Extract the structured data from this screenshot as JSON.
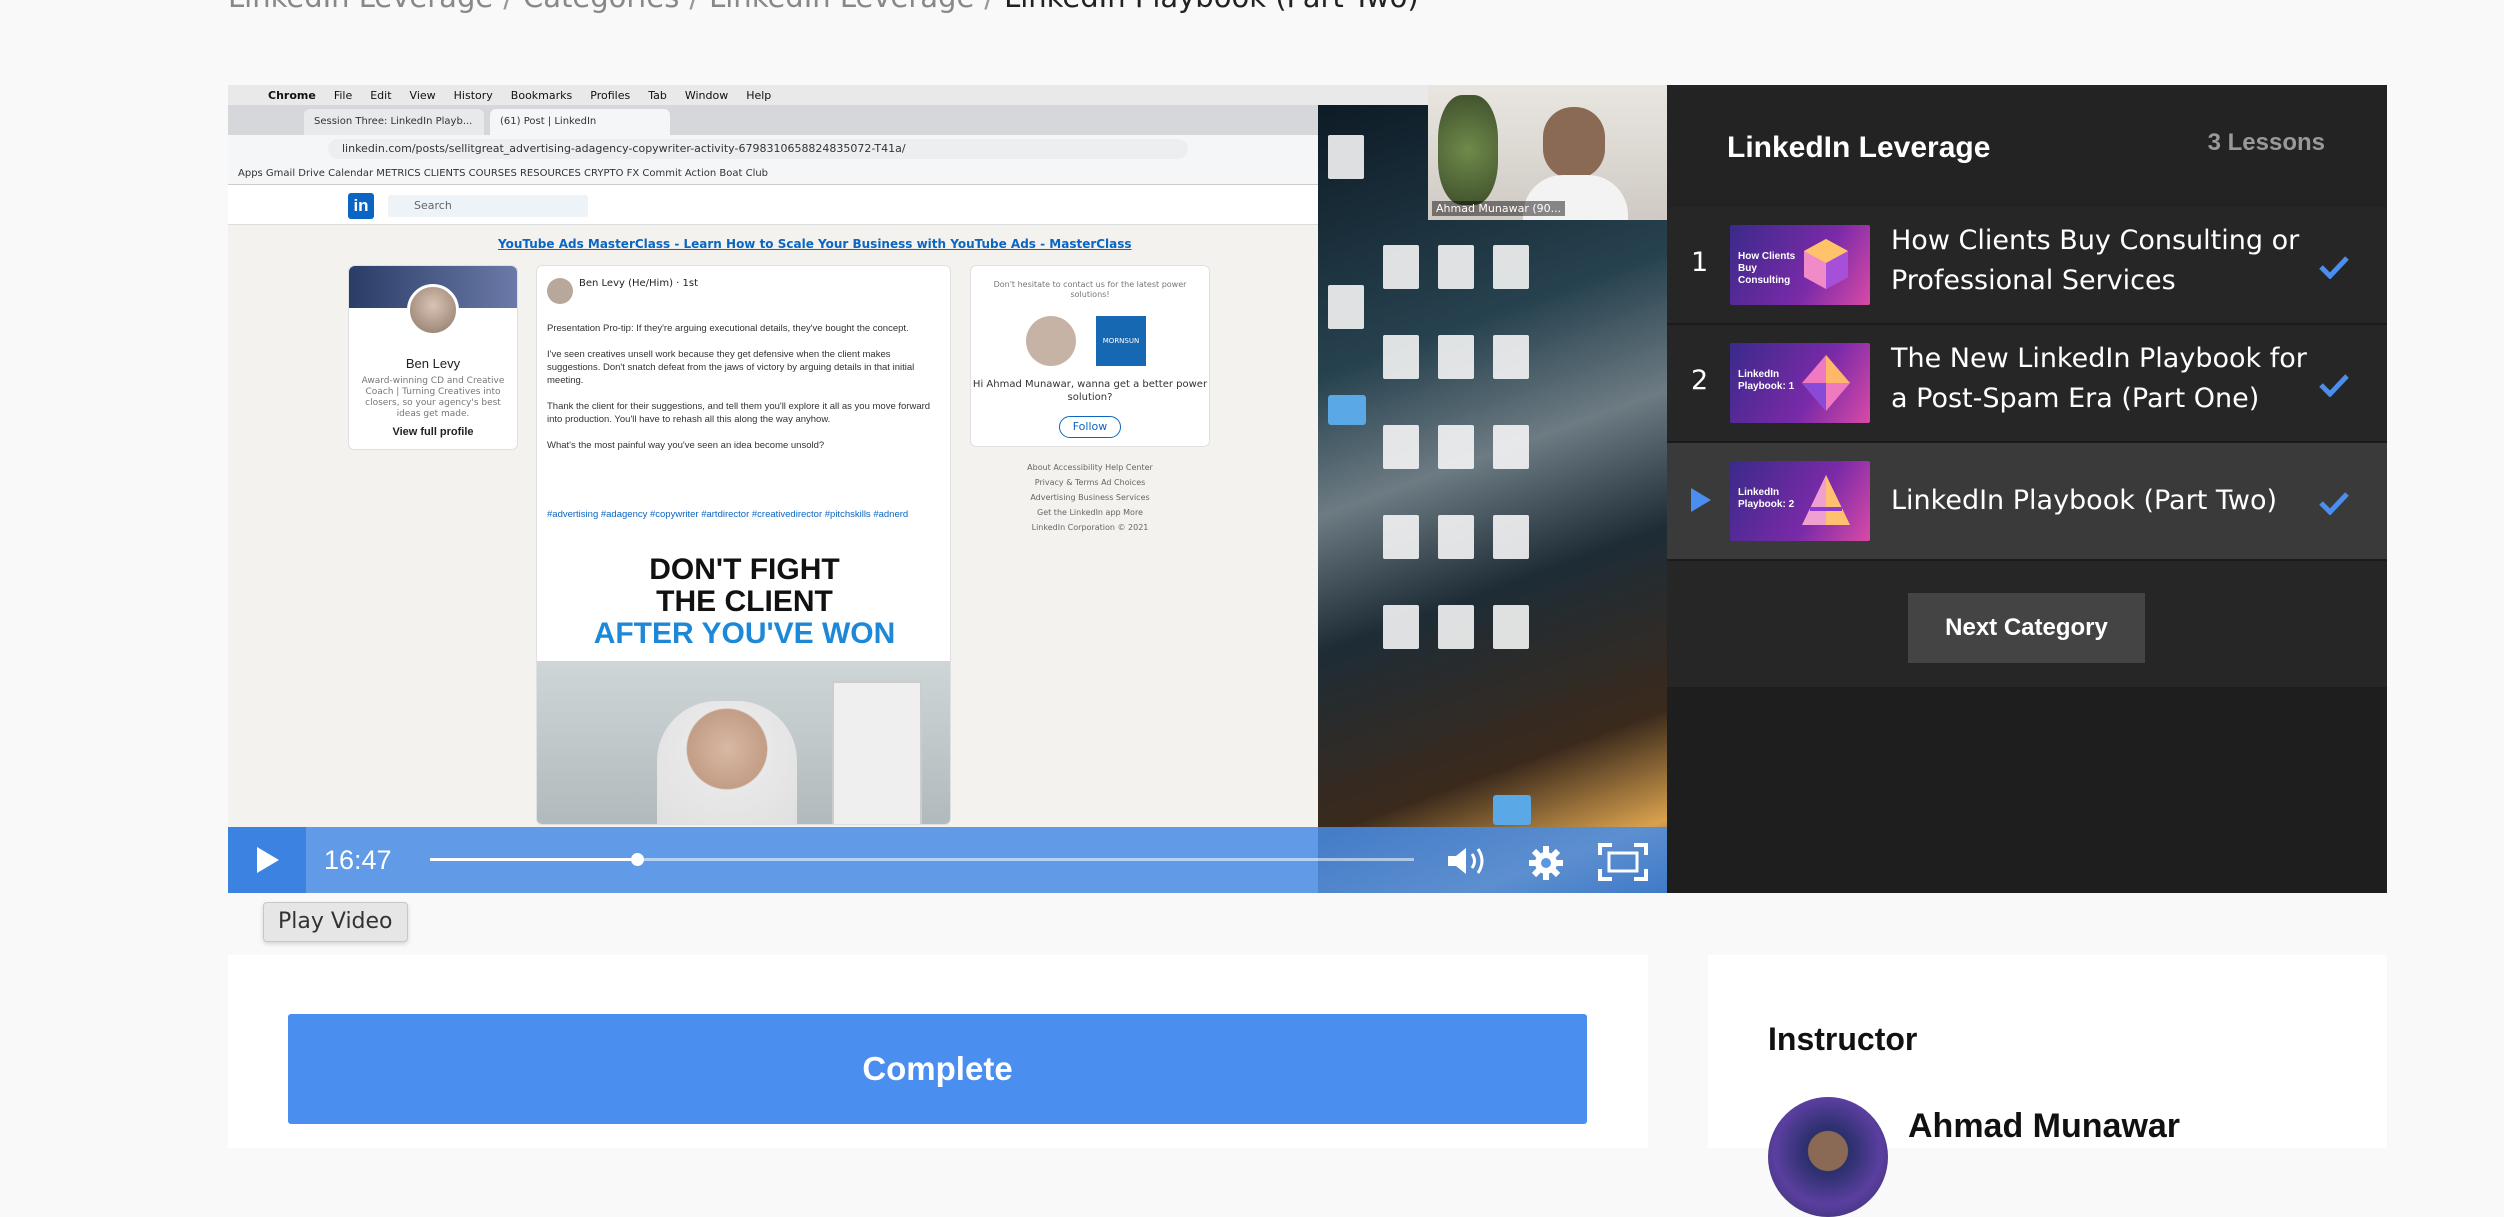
{
  "breadcrumb": {
    "items": [
      "LinkedIn Leverage",
      "Categories",
      "LinkedIn Leverage"
    ],
    "current": "LinkedIn Playbook (Part Two)",
    "separator": "/"
  },
  "video": {
    "time": "16:47",
    "progress_fraction": 0.21,
    "tooltip": "Play Video",
    "screen": {
      "mac_menu": [
        "Chrome",
        "File",
        "Edit",
        "View",
        "History",
        "Bookmarks",
        "Profiles",
        "Tab",
        "Window",
        "Help"
      ],
      "tabs": [
        "Session Three: LinkedIn Playb...",
        "(61) Post | LinkedIn"
      ],
      "url": "linkedin.com/posts/sellitgreat_advertising-adagency-copywriter-activity-6798310658824835072-T41a/",
      "bookmarks": "Apps   Gmail   Drive   Calendar   METRICS   CLIENTS   COURSES   RESOURCES   CRYPTO   FX   Commit Action   Boat Club",
      "search_placeholder": "Search",
      "promo": "YouTube Ads MasterClass - Learn How to Scale Your Business with YouTube Ads - MasterClass",
      "profile_name": "Ben Levy",
      "profile_desc": "Award-winning CD and Creative Coach | Turning Creatives into closers, so your agency's best ideas get made.",
      "profile_link": "View full profile",
      "post_author": "Ben Levy (He/Him) · 1st",
      "post_text": "Presentation Pro-tip: If they're arguing executional details, they've bought the concept.\n\nI've seen creatives unsell work because they get defensive when the client makes suggestions. Don't snatch defeat from the jaws of victory by arguing details in that initial meeting.\n\nThank the client for their suggestions, and tell them you'll explore it all as you move forward into production. You'll have to rehash all this along the way anyhow.\n\nWhat's the most painful way you've seen an idea become unsold?",
      "post_tags": "#advertising #adagency #copywriter #artdirector #creativedirector #pitchskills #adnerd",
      "headline_1": "DON'T FIGHT",
      "headline_2": "THE CLIENT",
      "headline_3": "AFTER YOU'VE WON",
      "ad_top": "Don't hesitate to contact us for the latest power solutions!",
      "ad_brand": "MORNSUN",
      "ad_hi": "Hi Ahmad Munawar, wanna get a better power solution?",
      "ad_follow": "Follow",
      "footer": "About   Accessibility   Help Center\nPrivacy & Terms   Ad Choices\nAdvertising   Business Services\nGet the LinkedIn app   More\nLinkedIn Corporation © 2021",
      "webcam_label": "Ahmad Munawar (90..."
    }
  },
  "playlist": {
    "title": "LinkedIn Leverage",
    "count": "3 Lessons",
    "lessons": [
      {
        "num": "1",
        "label": "How Clients Buy Consulting or Professional Services",
        "thumb": "How Clients Buy Consulting",
        "completed": true
      },
      {
        "num": "2",
        "label": "The New LinkedIn Playbook for a Post-Spam Era (Part One)",
        "thumb": "LinkedIn Playbook: 1",
        "completed": true
      },
      {
        "num": "3",
        "label": "LinkedIn Playbook (Part Two)",
        "thumb": "LinkedIn Playbook: 2",
        "completed": true
      }
    ],
    "next_label": "Next Category"
  },
  "complete": {
    "label": "Complete"
  },
  "instructor": {
    "heading": "Instructor",
    "name": "Ahmad Munawar"
  },
  "colors": {
    "accent": "#4a8ef0",
    "check": "#4a8ef0",
    "panel": "#232323"
  }
}
